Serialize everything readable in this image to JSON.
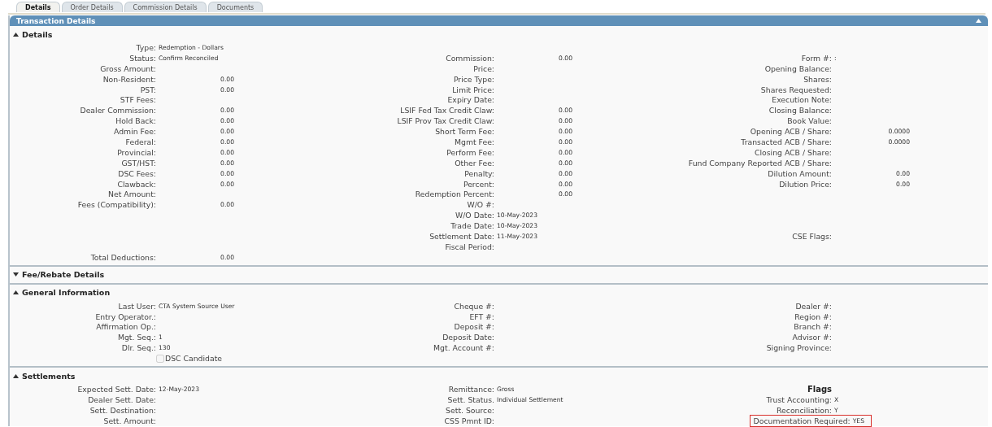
{
  "tabs": [
    {
      "label": "Details",
      "selected": true
    },
    {
      "label": "Order Details",
      "selected": false
    },
    {
      "label": "Commission Details",
      "selected": false
    },
    {
      "label": "Documents",
      "selected": false
    }
  ],
  "panel": {
    "title": "Transaction Details",
    "expanded": true
  },
  "sections": [
    {
      "title": "Details",
      "expanded": true,
      "columns": [
        [
          {
            "kind": "text",
            "label": "Type:",
            "value": "Redemption - Dollars"
          },
          {
            "kind": "text",
            "label": "Status:",
            "value": "Confirm Reconciled"
          },
          {
            "kind": "text",
            "label": "Gross Amount:"
          },
          {
            "kind": "amount",
            "label": "Non-Resident:",
            "value": "0.00"
          },
          {
            "kind": "amount",
            "label": "PST:",
            "value": "0.00"
          },
          {
            "kind": "text",
            "label": "STF Fees:"
          },
          {
            "kind": "amount",
            "label": "Dealer Commission:",
            "value": "0.00"
          },
          {
            "kind": "amount",
            "label": "Hold Back:",
            "value": "0.00"
          },
          {
            "kind": "amount",
            "label": "Admin Fee:",
            "value": "0.00"
          },
          {
            "kind": "amount",
            "label": "Federal:",
            "value": "0.00"
          },
          {
            "kind": "amount",
            "label": "Provincial:",
            "value": "0.00"
          },
          {
            "kind": "amount",
            "label": "GST/HST:",
            "value": "0.00"
          },
          {
            "kind": "amount",
            "label": "DSC Fees:",
            "value": "0.00"
          },
          {
            "kind": "amount",
            "label": "Clawback:",
            "value": "0.00"
          },
          {
            "kind": "text",
            "label": "Net Amount:"
          },
          {
            "kind": "amount",
            "label": "Fees (Compatibility):",
            "value": "0.00"
          },
          {
            "kind": "blank"
          },
          {
            "kind": "blank"
          },
          {
            "kind": "blank"
          },
          {
            "kind": "blank"
          },
          {
            "kind": "amount",
            "label": "Total Deductions:",
            "value": "0.00"
          }
        ],
        [
          {
            "kind": "blank"
          },
          {
            "kind": "amount",
            "label": "Commission:",
            "value": "0.00"
          },
          {
            "kind": "text",
            "label": "Price:"
          },
          {
            "kind": "text",
            "label": "Price Type:"
          },
          {
            "kind": "text",
            "label": "Limit Price:"
          },
          {
            "kind": "text",
            "label": "Expiry Date:"
          },
          {
            "kind": "amount",
            "label": "LSIF Fed Tax Credit Claw:",
            "value": "0.00"
          },
          {
            "kind": "amount",
            "label": "LSIF Prov Tax Credit Claw:",
            "value": "0.00"
          },
          {
            "kind": "amount",
            "label": "Short Term Fee:",
            "value": "0.00"
          },
          {
            "kind": "amount",
            "label": "Mgmt Fee:",
            "value": "0.00"
          },
          {
            "kind": "amount",
            "label": "Perform Fee:",
            "value": "0.00"
          },
          {
            "kind": "amount",
            "label": "Other Fee:",
            "value": "0.00"
          },
          {
            "kind": "amount",
            "label": "Penalty:",
            "value": "0.00"
          },
          {
            "kind": "amount",
            "label": "Percent:",
            "value": "0.00"
          },
          {
            "kind": "amount",
            "label": "Redemption Percent:",
            "value": "0.00"
          },
          {
            "kind": "text",
            "label": "W/O #:"
          },
          {
            "kind": "text",
            "label": "W/O Date:",
            "value": "10-May-2023"
          },
          {
            "kind": "text",
            "label": "Trade Date:",
            "value": "10-May-2023"
          },
          {
            "kind": "text",
            "label": "Settlement Date:",
            "value": "11-May-2023"
          },
          {
            "kind": "text",
            "label": "Fiscal Period:"
          }
        ],
        [
          {
            "kind": "blank"
          },
          {
            "kind": "text",
            "label": "Form #:",
            "value": ":"
          },
          {
            "kind": "text",
            "label": "Opening Balance:"
          },
          {
            "kind": "text",
            "label": "Shares:"
          },
          {
            "kind": "text",
            "label": "Shares Requested:"
          },
          {
            "kind": "text",
            "label": "Execution Note:"
          },
          {
            "kind": "text",
            "label": "Closing Balance:"
          },
          {
            "kind": "text",
            "label": "Book Value:"
          },
          {
            "kind": "amount",
            "label": "Opening ACB / Share:",
            "value": "0.0000"
          },
          {
            "kind": "amount",
            "label": "Transacted ACB / Share:",
            "value": "0.0000"
          },
          {
            "kind": "text",
            "label": "Closing ACB / Share:"
          },
          {
            "kind": "text",
            "label": "Fund Company Reported ACB / Share:"
          },
          {
            "kind": "amount",
            "label": "Dilution Amount:",
            "value": "0.00"
          },
          {
            "kind": "amount",
            "label": "Dilution Price:",
            "value": "0.00"
          },
          {
            "kind": "blank"
          },
          {
            "kind": "blank"
          },
          {
            "kind": "blank"
          },
          {
            "kind": "blank"
          },
          {
            "kind": "text",
            "label": "CSE Flags:"
          }
        ]
      ]
    },
    {
      "title": "Fee/Rebate Details",
      "expanded": false
    },
    {
      "title": "General Information",
      "expanded": true,
      "columns": [
        [
          {
            "kind": "text",
            "label": "Last User:",
            "value": "CTA System Source User"
          },
          {
            "kind": "text",
            "label": "Entry Operator.:"
          },
          {
            "kind": "text",
            "label": "Affirmation Op.:"
          },
          {
            "kind": "text",
            "label": "Mgt. Seq.:",
            "value": "1"
          },
          {
            "kind": "text",
            "label": "Dlr. Seq.:",
            "value": "130"
          },
          {
            "kind": "checkbox",
            "label": "DSC Candidate",
            "checked": false
          }
        ],
        [
          {
            "kind": "text",
            "label": "Cheque #:"
          },
          {
            "kind": "text",
            "label": "EFT #:"
          },
          {
            "kind": "text",
            "label": "Deposit #:"
          },
          {
            "kind": "text",
            "label": "Deposit Date:"
          },
          {
            "kind": "text",
            "label": "Mgt. Account #:"
          }
        ],
        [
          {
            "kind": "text",
            "label": "Dealer #:"
          },
          {
            "kind": "text",
            "label": "Region #:"
          },
          {
            "kind": "text",
            "label": "Branch #:"
          },
          {
            "kind": "text",
            "label": "Advisor #:"
          },
          {
            "kind": "text",
            "label": "Signing Province:"
          }
        ]
      ]
    },
    {
      "title": "Settlements",
      "expanded": true,
      "columns": [
        [
          {
            "kind": "text",
            "label": "Expected Sett. Date:",
            "value": "12-May-2023"
          },
          {
            "kind": "text",
            "label": "Dealer Sett. Date:"
          },
          {
            "kind": "text",
            "label": "Sett. Destination:"
          },
          {
            "kind": "text",
            "label": "Sett. Amount:"
          }
        ],
        [
          {
            "kind": "text",
            "label": "Remittance:",
            "value": "Gross"
          },
          {
            "kind": "text",
            "label": "Sett. Status.",
            "value": "Individual Settlement"
          },
          {
            "kind": "text",
            "label": "Sett. Source:"
          },
          {
            "kind": "text",
            "label": "CSS Pmnt ID:"
          }
        ],
        [
          {
            "kind": "heading",
            "label": "Flags"
          },
          {
            "kind": "text",
            "label": "Trust Accounting:",
            "value": "X"
          },
          {
            "kind": "text",
            "label": "Reconciliation:",
            "value": "Y"
          },
          {
            "kind": "text",
            "label": "Documentation Required:",
            "value": "YES",
            "highlighted": true
          }
        ]
      ]
    }
  ]
}
